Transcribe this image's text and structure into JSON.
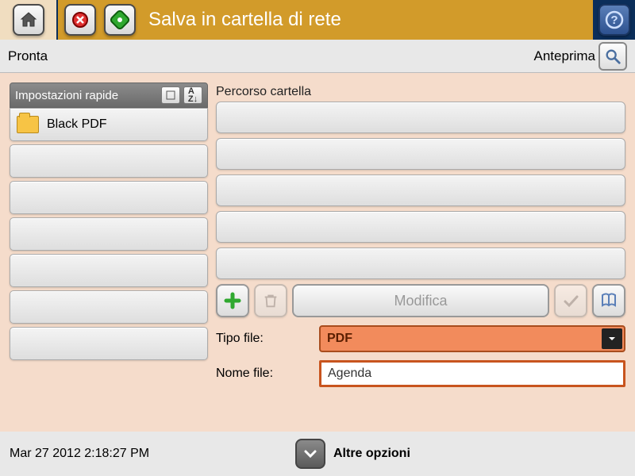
{
  "header": {
    "title": "Salva in cartella di rete"
  },
  "status": {
    "ready": "Pronta",
    "preview": "Anteprima"
  },
  "quicksets": {
    "header": "Impostazioni rapide",
    "items": [
      "Black PDF",
      "",
      "",
      "",
      "",
      "",
      ""
    ]
  },
  "folder_path": {
    "label": "Percorso cartella",
    "rows": [
      "",
      "",
      "",
      "",
      "",
      ""
    ]
  },
  "actions": {
    "modify": "Modifica"
  },
  "file_type": {
    "label": "Tipo file:",
    "value": "PDF"
  },
  "file_name": {
    "label": "Nome file:",
    "value": "Agenda"
  },
  "footer": {
    "timestamp": "Mar 27 2012 2:18:27 PM",
    "more": "Altre opzioni"
  }
}
